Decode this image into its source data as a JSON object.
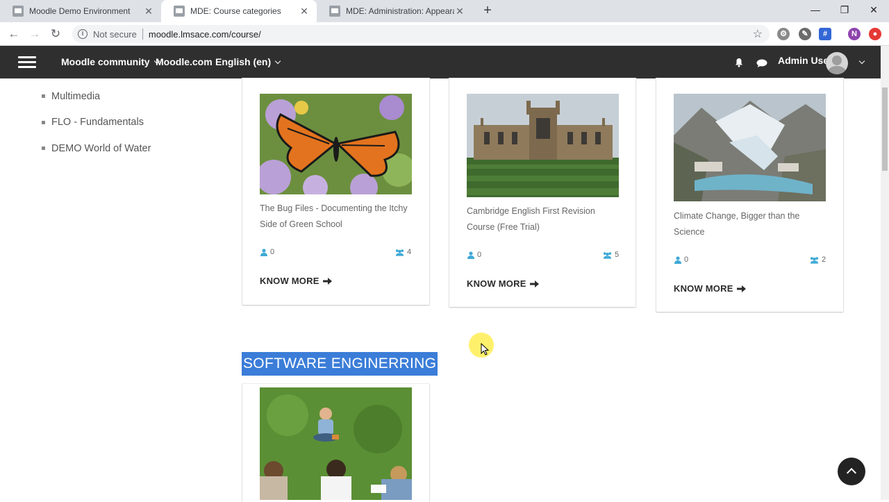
{
  "browser": {
    "tabs": [
      {
        "title": "Moodle Demo Environment",
        "active": false
      },
      {
        "title": "MDE: Course categories",
        "active": true
      },
      {
        "title": "MDE: Administration: Appearanc",
        "active": false
      }
    ],
    "security_label": "Not secure",
    "url": "moodle.lmsace.com/course/",
    "profile_initial": "N"
  },
  "navbar": {
    "community_label": "Moodle community",
    "moodlecom_label": "Moodle.com",
    "language_label": "English (en)",
    "user_name": "Admin User"
  },
  "sidebar": {
    "categories": [
      "Multimedia",
      "FLO - Fundamentals",
      "DEMO World of Water"
    ]
  },
  "courses": [
    {
      "title_line1": "The Bug Files - Documenting the Itchy",
      "title_line2": "Side of Green School",
      "students": "0",
      "enrolled": "4",
      "action": "KNOW MORE"
    },
    {
      "title_line1": "Cambridge English First Revision",
      "title_line2": "Course (Free Trial)",
      "students": "0",
      "enrolled": "5",
      "action": "KNOW MORE"
    },
    {
      "title_line1": "Climate Change, Bigger than the",
      "title_line2": "Science",
      "students": "0",
      "enrolled": "2",
      "action": "KNOW MORE"
    }
  ],
  "section": {
    "title": "SOFTWARE ENGINERRING"
  },
  "colors": {
    "navbar": "#2f2f2f",
    "accent_icon": "#3fa9d6",
    "selection": "#3b7dd8"
  }
}
